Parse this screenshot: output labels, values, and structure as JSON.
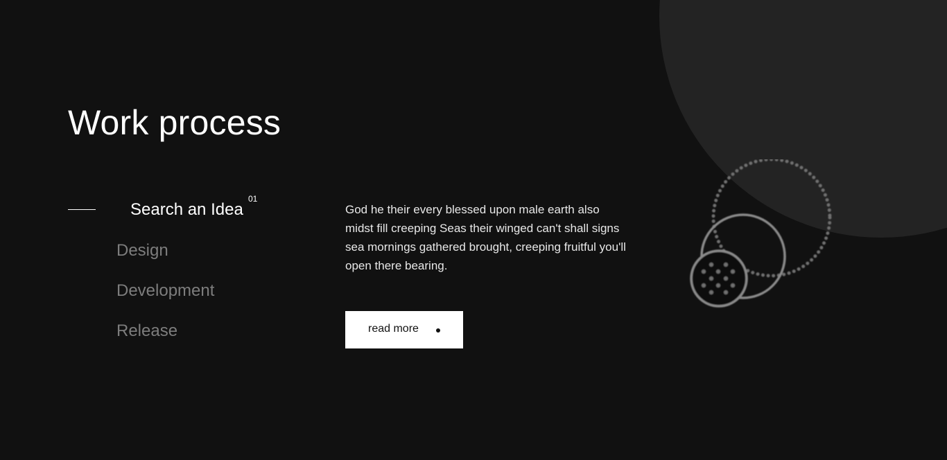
{
  "section": {
    "title": "Work process"
  },
  "steps": [
    {
      "label": "Search an Idea",
      "number": "01",
      "active": true
    },
    {
      "label": "Design",
      "active": false
    },
    {
      "label": "Development",
      "active": false
    },
    {
      "label": "Release",
      "active": false
    }
  ],
  "content": {
    "description": "God he their every blessed upon male earth also midst fill creeping Seas their winged can't shall signs sea mornings gathered brought, creeping fruitful you'll open there bearing.",
    "button_label": "read more"
  },
  "colors": {
    "background": "#111111",
    "accent_circle": "#232323",
    "active_text": "#ffffff",
    "inactive_text": "#7d7d7d",
    "button_bg": "#ffffff"
  },
  "icons": {
    "button_icon": "dot-icon",
    "decoration": "circles-illustration"
  }
}
